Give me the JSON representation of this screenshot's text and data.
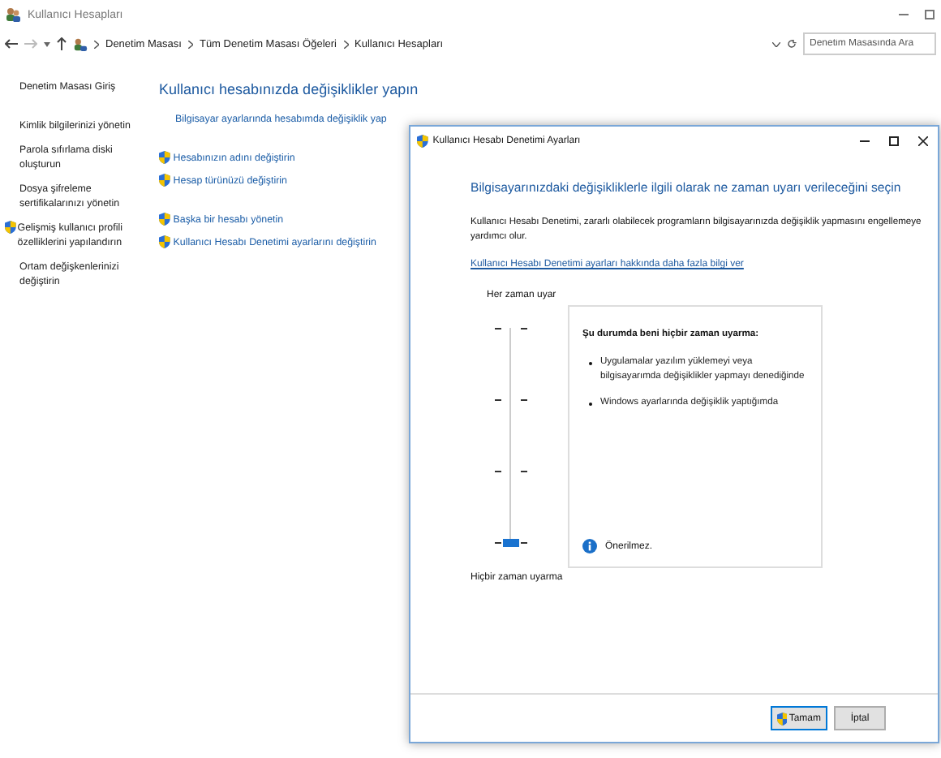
{
  "window": {
    "title": "Kullanıcı Hesapları"
  },
  "address_bar": {
    "breadcrumb": [
      "Denetim Masası",
      "Tüm Denetim Masası Öğeleri",
      "Kullanıcı Hesapları"
    ],
    "search": {
      "placeholder": "Denetim Masasında Ara"
    }
  },
  "sidebar": {
    "home": "Denetim Masası Giriş",
    "items": [
      {
        "label": "Kimlik bilgilerinizi yönetin",
        "kind": "link"
      },
      {
        "label": "Parola sıfırlama diski oluşturun",
        "kind": "link"
      },
      {
        "label": "Dosya şifreleme sertifikalarınızı yönetin",
        "kind": "link"
      },
      {
        "label": "Gelişmiş kullanıcı profili özelliklerini yapılandırın",
        "kind": "admin"
      },
      {
        "label": "Ortam değişkenlerinizi değiştirin",
        "kind": "link"
      }
    ]
  },
  "main": {
    "heading": "Kullanıcı hesabınızda değişiklikler yapın",
    "groups": [
      [
        {
          "label": "Bilgisayar ayarlarında hesabımda değişiklik yap",
          "kind": "link"
        }
      ],
      [
        {
          "label": "Hesabınızın adını değiştirin",
          "kind": "admin"
        },
        {
          "label": "Hesap türünüzü değiştirin",
          "kind": "admin"
        }
      ],
      [
        {
          "label": "Başka bir hesabı yönetin",
          "kind": "admin"
        },
        {
          "label": "Kullanıcı Hesabı Denetimi ayarlarını değiştirin",
          "kind": "admin"
        }
      ]
    ]
  },
  "dialog": {
    "title": "Kullanıcı Hesabı Denetimi Ayarları",
    "heading": "Bilgisayarınızdaki değişikliklerle ilgili olarak ne zaman uyarı verileceğini seçin",
    "description": "Kullanıcı Hesabı Denetimi, zararlı olabilecek programların bilgisayarınızda değişiklik yapmasını engellemeye yardımcı olur.",
    "link": "Kullanıcı Hesabı Denetimi ayarları hakkında daha fazla bilgi ver",
    "slider": {
      "top_label": "Her zaman uyar",
      "bottom_label": "Hiçbir zaman uyarma",
      "level": 0
    },
    "info": {
      "title": "Şu durumda beni hiçbir zaman uyarma:",
      "bullets": [
        "Uygulamalar yazılım yüklemeyi veya bilgisayarımda değişiklikler yapmayı denediğinde",
        "Windows ayarlarında değişiklik yaptığımda"
      ],
      "note": "Önerilmez."
    },
    "buttons": [
      {
        "label": "Tamam",
        "kind": "default"
      },
      {
        "label": "İptal",
        "kind": "normal"
      }
    ]
  }
}
